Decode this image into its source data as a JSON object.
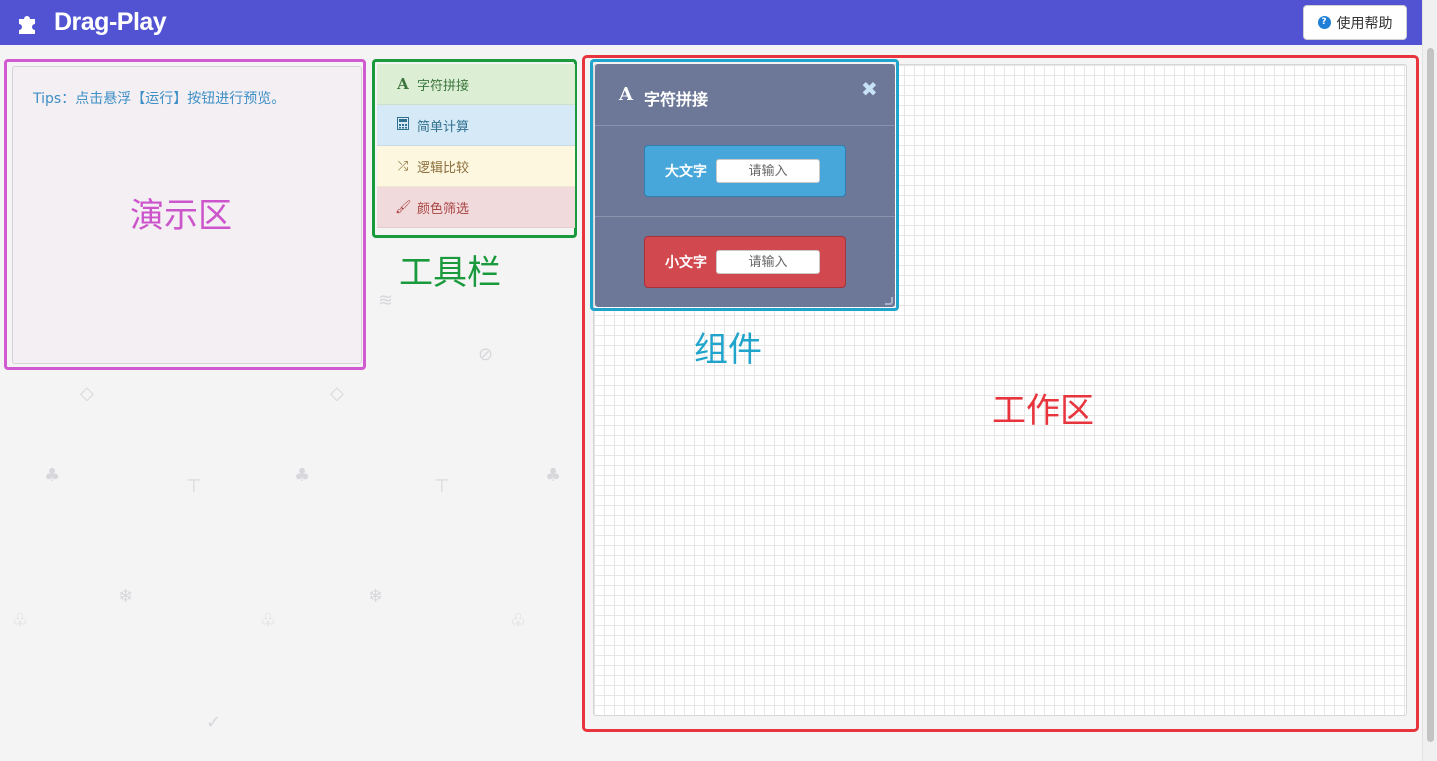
{
  "app": {
    "brand": "Drag-Play",
    "help_label": "使用帮助"
  },
  "demo": {
    "tips": "Tips：点击悬浮【运行】按钮进行预览。",
    "area_label": "演示区"
  },
  "toolbar": {
    "items": [
      {
        "label": "字符拼接",
        "icon": "font-icon"
      },
      {
        "label": "简单计算",
        "icon": "calculator-icon"
      },
      {
        "label": "逻辑比较",
        "icon": "shuffle-icon"
      },
      {
        "label": "颜色筛选",
        "icon": "brush-icon"
      }
    ],
    "area_label": "工具栏"
  },
  "component": {
    "title": "字符拼接",
    "close_icon": "close-icon",
    "fields": [
      {
        "label": "大文字",
        "placeholder": "请输入",
        "color": "#47a7db"
      },
      {
        "label": "小文字",
        "placeholder": "请输入",
        "color": "#d2484f"
      }
    ],
    "area_label": "组件"
  },
  "workspace": {
    "area_label": "工作区"
  },
  "colors": {
    "navbar": "#5153d2",
    "demo_outline": "#d05bd1",
    "toolbar_outline": "#1a9a3d",
    "component_outline": "#20a4cb",
    "workspace_outline": "#e8353d"
  }
}
